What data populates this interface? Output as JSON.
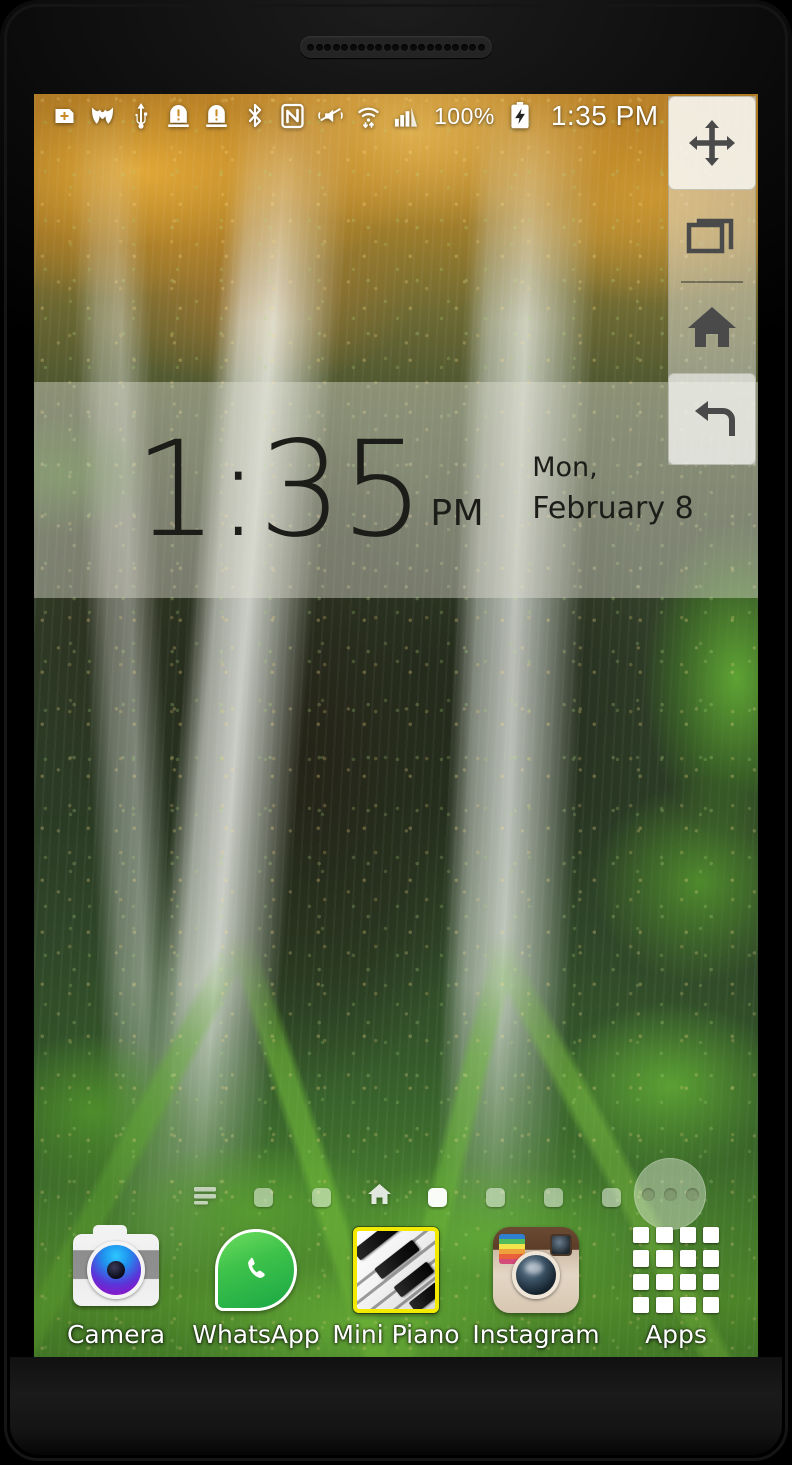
{
  "device": {
    "hardware": {
      "speaker_grille_holes": 21
    }
  },
  "status_bar": {
    "icons": [
      {
        "name": "medical-card-icon",
        "glyph": "card-plus"
      },
      {
        "name": "w-app-icon",
        "glyph": "w-logo"
      },
      {
        "name": "usb-icon",
        "glyph": "usb"
      },
      {
        "name": "alert-warning-icon-1",
        "glyph": "alert-box"
      },
      {
        "name": "alert-warning-icon-2",
        "glyph": "alert-box"
      },
      {
        "name": "bluetooth-icon",
        "glyph": "bluetooth"
      },
      {
        "name": "nfc-icon",
        "glyph": "nfc"
      },
      {
        "name": "mute-vibrate-icon",
        "glyph": "speaker-muted"
      },
      {
        "name": "wifi-icon",
        "glyph": "wifi-transfer"
      },
      {
        "name": "cell-signal-icon",
        "glyph": "signal-bars"
      }
    ],
    "battery_percent": "100%",
    "battery_state": "charging",
    "clock": "1:35 PM"
  },
  "clock_widget": {
    "time": "1:35",
    "meridiem": "PM",
    "weekday": "Mon,",
    "date": "February 8"
  },
  "floating_nav": {
    "buttons": [
      {
        "name": "nav-drag-handle",
        "label": "Move",
        "glyph": "move-arrows"
      },
      {
        "name": "nav-recent",
        "label": "Recent apps",
        "glyph": "recent-apps"
      },
      {
        "name": "nav-home",
        "label": "Home",
        "glyph": "home"
      },
      {
        "name": "nav-back",
        "label": "Back",
        "glyph": "back-arrow"
      }
    ]
  },
  "page_indicators": {
    "cells": [
      {
        "name": "page-indicator-menu",
        "type": "glyph",
        "glyph": "list-menu"
      },
      {
        "name": "page-indicator-1",
        "type": "dot",
        "active": false
      },
      {
        "name": "page-indicator-2",
        "type": "dot",
        "active": false
      },
      {
        "name": "page-indicator-home",
        "type": "glyph",
        "glyph": "home"
      },
      {
        "name": "page-indicator-4",
        "type": "dot",
        "active": true
      },
      {
        "name": "page-indicator-5",
        "type": "dot",
        "active": false
      },
      {
        "name": "page-indicator-6",
        "type": "dot",
        "active": false
      },
      {
        "name": "page-indicator-7",
        "type": "dot",
        "active": false
      }
    ],
    "active_index": 4
  },
  "overflow_button": {
    "name": "overflow-menu-button",
    "dots": 3
  },
  "dock": {
    "items": [
      {
        "label": "Camera",
        "icon": "camera-icon",
        "selected": false
      },
      {
        "label": "WhatsApp",
        "icon": "whatsapp-icon",
        "selected": false
      },
      {
        "label": "Mini Piano",
        "icon": "mini-piano-icon",
        "selected": true
      },
      {
        "label": "Instagram",
        "icon": "instagram-icon",
        "selected": false
      },
      {
        "label": "Apps",
        "icon": "apps-grid-icon",
        "selected": false
      }
    ]
  },
  "colors": {
    "selection_border": "#f2ea00",
    "status_text": "#ffffff",
    "clock_text": "#1c1c18",
    "widget_overlay": "rgba(228,226,214,0.42)",
    "nav_panel": "rgba(236,236,232,0.46)"
  }
}
